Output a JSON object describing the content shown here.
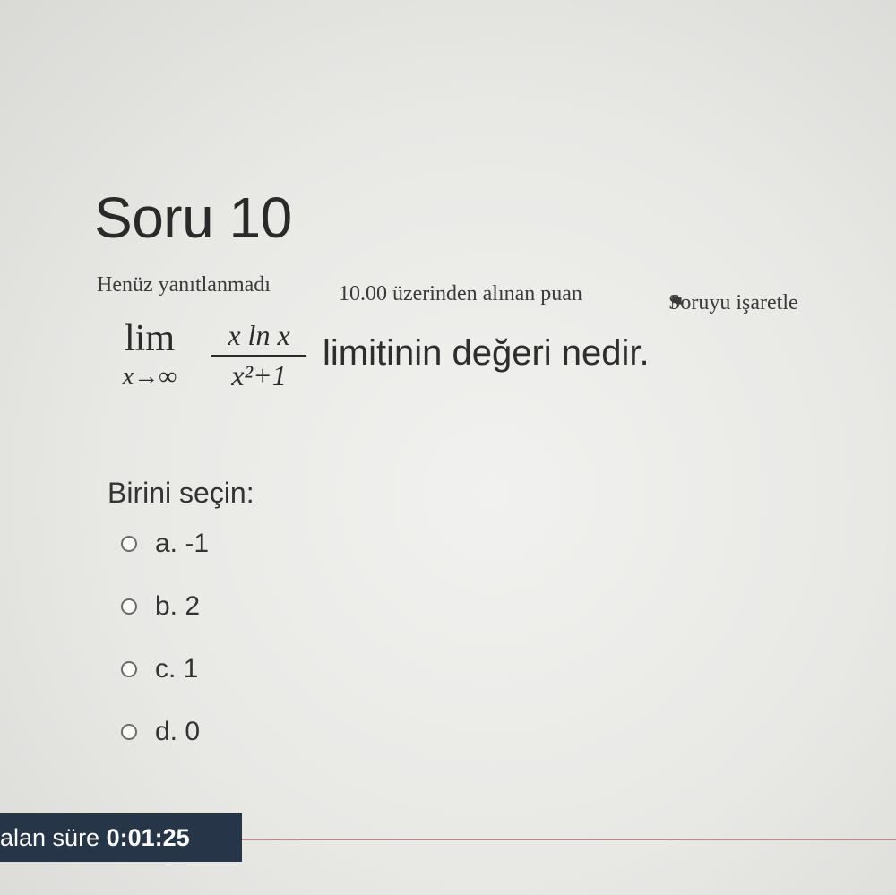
{
  "question": {
    "title": "Soru 10",
    "status": "Henüz yanıtlanmadı",
    "grade": "10.00 üzerinden alınan puan",
    "flag_icon": "flag-icon",
    "flag_label": "Soruyu işaretle",
    "math": {
      "lim": "lim",
      "lim_sub": "x→∞",
      "numerator": "x ln x",
      "denominator": "x²+1"
    },
    "text": "limitinin değeri nedir.",
    "prompt": "Birini seçin:",
    "options": [
      {
        "label": "a. -1"
      },
      {
        "label": "b. 2"
      },
      {
        "label": "c. 1"
      },
      {
        "label": "d. 0"
      }
    ]
  },
  "timer": {
    "prefix": "alan süre",
    "value": "0:01:25"
  },
  "colors": {
    "timer_bg": "#263548",
    "divider": "#b9878a"
  }
}
